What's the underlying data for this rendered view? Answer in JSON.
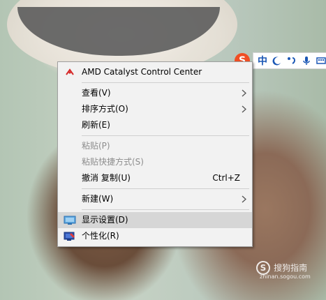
{
  "ime_toolbar": {
    "logo_text": "S",
    "chinese_mode": "中",
    "icons": [
      "moon-icon",
      "punctuation-icon",
      "microphone-icon",
      "keyboard-icon"
    ]
  },
  "context_menu": {
    "items": [
      {
        "label": "AMD Catalyst Control Center",
        "icon": "amd-catalyst-icon",
        "enabled": true
      },
      {
        "label": "查看(V)",
        "submenu": true,
        "enabled": true
      },
      {
        "label": "排序方式(O)",
        "submenu": true,
        "enabled": true
      },
      {
        "label": "刷新(E)",
        "enabled": true
      },
      {
        "label": "粘贴(P)",
        "enabled": false
      },
      {
        "label": "粘贴快捷方式(S)",
        "enabled": false
      },
      {
        "label": "撤消 复制(U)",
        "shortcut": "Ctrl+Z",
        "enabled": true
      },
      {
        "label": "新建(W)",
        "submenu": true,
        "enabled": true
      },
      {
        "label": "显示设置(D)",
        "icon": "display-settings-icon",
        "enabled": true,
        "highlighted": true
      },
      {
        "label": "个性化(R)",
        "icon": "personalize-icon",
        "enabled": true
      }
    ]
  },
  "watermark": {
    "logo_text": "S",
    "text": "搜狗指南",
    "url": "zhinan.sogou.com"
  },
  "colors": {
    "menu_background": "#f2f2f2",
    "highlight": "#d6d6d6",
    "disabled_text": "#8d8d8d",
    "ime_blue": "#1a57b5",
    "ime_logo": "#f04e23"
  }
}
